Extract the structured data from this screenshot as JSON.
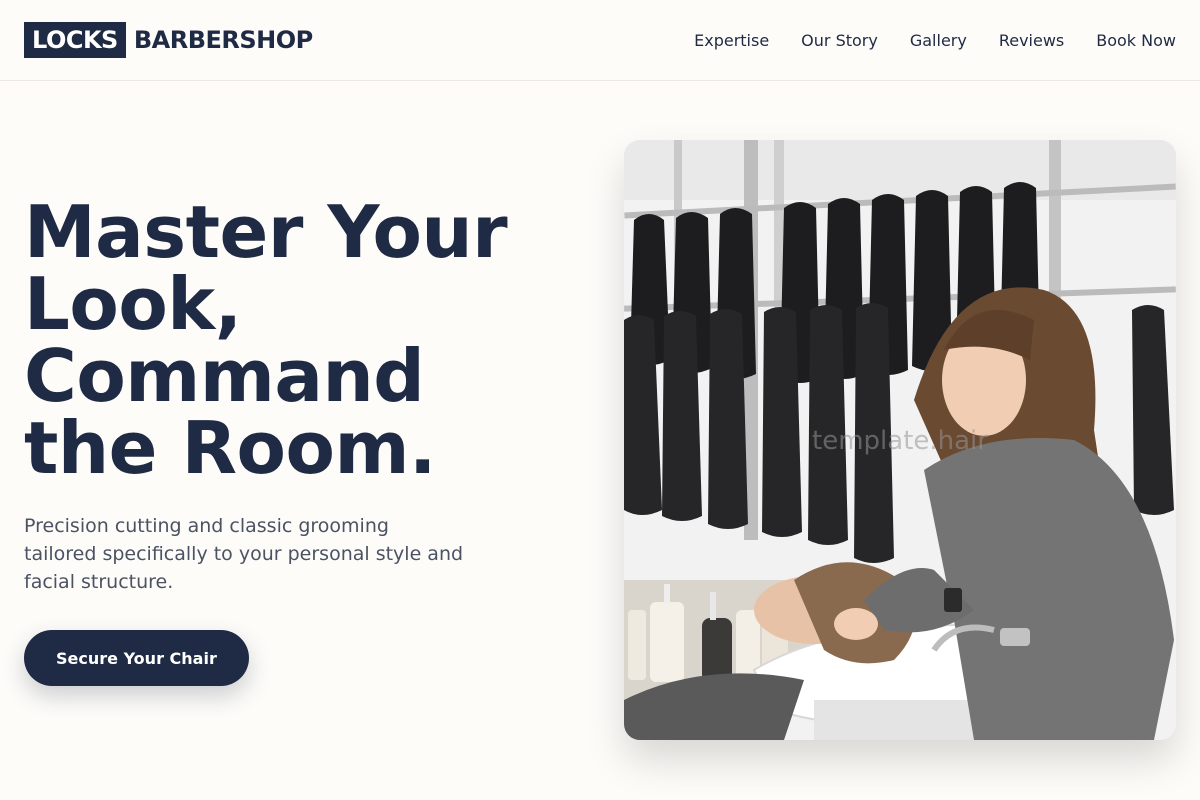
{
  "brand": {
    "logo_box": "LOCKS",
    "logo_text": "BARBERSHOP"
  },
  "nav": {
    "items": [
      {
        "label": "Expertise"
      },
      {
        "label": "Our Story"
      },
      {
        "label": "Gallery"
      },
      {
        "label": "Reviews"
      },
      {
        "label": "Book Now"
      }
    ]
  },
  "hero": {
    "headline_lines": [
      "Master Your",
      "Look,",
      "Command",
      "the Room."
    ],
    "subtitle": "Precision cutting and classic grooming tailored specifically to your personal style and facial structure.",
    "cta_label": "Secure Your Chair",
    "image_watermark": "template.hair"
  },
  "colors": {
    "primary": "#1f2a44",
    "background": "#fdfcf9",
    "muted_text": "#4b5363"
  }
}
